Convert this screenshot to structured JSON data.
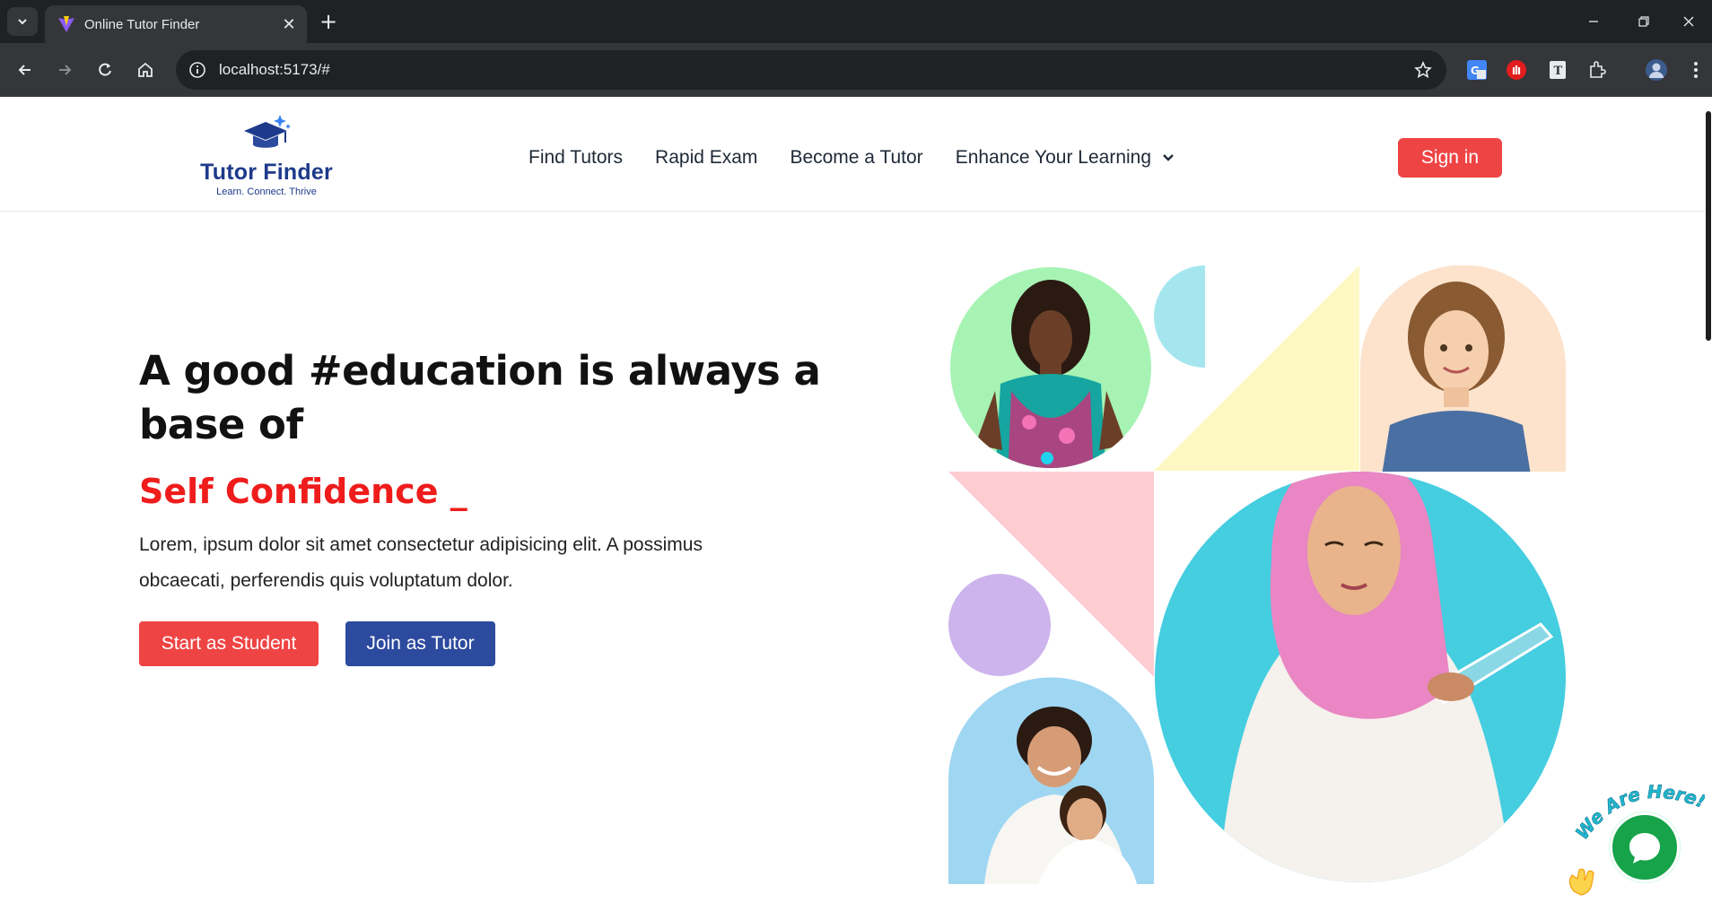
{
  "browser": {
    "tab_title": "Online Tutor Finder",
    "url": "localhost:5173/#"
  },
  "header": {
    "logo_name": "Tutor Finder",
    "logo_tagline": "Learn. Connect. Thrive",
    "nav": [
      {
        "label": "Find Tutors"
      },
      {
        "label": "Rapid Exam"
      },
      {
        "label": "Become a Tutor"
      },
      {
        "label": "Enhance Your Learning"
      }
    ],
    "signin_label": "Sign in"
  },
  "hero": {
    "title": "A good #education is always a base of",
    "typed_text": "Self Confidence _",
    "description": "Lorem, ipsum dolor sit amet consectetur adipisicing elit. A possimus obcaecati, perferendis quis voluptatum dolor.",
    "student_button": "Start as Student",
    "tutor_button": "Join as Tutor"
  },
  "chat": {
    "badge_text": "We Are Here!"
  },
  "colors": {
    "accent_red": "#ef4444",
    "headline_red": "#ef1c1c",
    "brand_blue": "#2c4a9e",
    "logo_blue": "#1e3a8a",
    "chat_green": "#16a34a"
  }
}
